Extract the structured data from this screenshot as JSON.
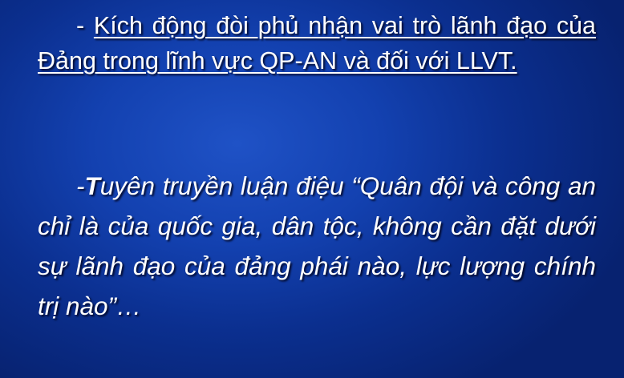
{
  "slide": {
    "point1": {
      "prefix": "- ",
      "text": "Kích động đòi phủ nhận vai trò lãnh đạo của Đảng trong lĩnh vực QP-AN và đối với LLVT."
    },
    "point2": {
      "prefix": "-",
      "first_letter": "T",
      "text": "uyên truyền luận điệu “Quân đội và công an chỉ là của quốc gia, dân tộc, không cần đặt dưới sự lãnh đạo của đảng phái nào, lực lượng chính trị nào”…"
    }
  },
  "colors": {
    "background": "#1341b0",
    "text": "#ffffff"
  }
}
